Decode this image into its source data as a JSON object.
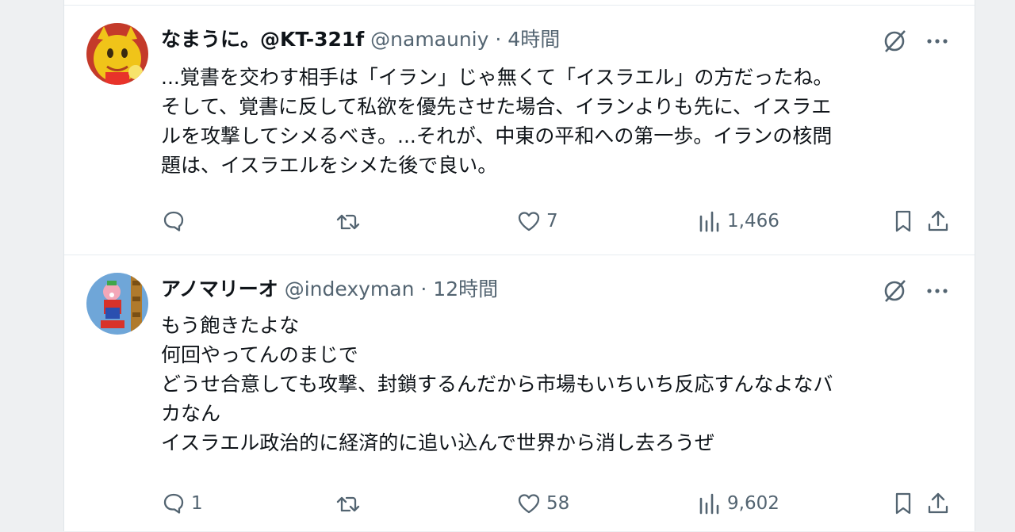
{
  "posts": [
    {
      "display_name": "なまうに。@KT-321f",
      "handle": "@namauniy",
      "separator": "·",
      "time": "4時間",
      "body_lines": [
        "...覚書を交わす相手は「イラン」じゃ無くて「イスラエル」の方だったね。",
        "そして、覚書に反して私欲を優先させた場合、イランよりも先に、イスラエ",
        "ルを攻撃してシメるべき。...それが、中東の平和への第一歩。イランの核問",
        "題は、イスラエルをシメた後で良い。"
      ],
      "replies": "",
      "reposts": "",
      "likes": "7",
      "views": "1,466"
    },
    {
      "display_name": "アノマリーオ",
      "handle": "@indexyman",
      "separator": "·",
      "time": "12時間",
      "body_lines": [
        "もう飽きたよな",
        "何回やってんのまじで",
        "どうせ合意しても攻撃、封鎖するんだから市場もいちいち反応すんなよなバ",
        "カなん",
        "イスラエル政治的に経済的に追い込んで世界から消し去ろうぜ"
      ],
      "replies": "1",
      "reposts": "",
      "likes": "58",
      "views": "9,602"
    }
  ],
  "icons": {
    "reply": "reply-icon",
    "repost": "repost-icon",
    "like": "heart-icon",
    "views": "views-chart-icon",
    "bookmark": "bookmark-icon",
    "share": "share-icon",
    "grok": "grok-icon",
    "more": "more-dots-icon"
  },
  "colors": {
    "text": "#0f1419",
    "secondary": "#536471",
    "divider": "#e6ecf0"
  }
}
